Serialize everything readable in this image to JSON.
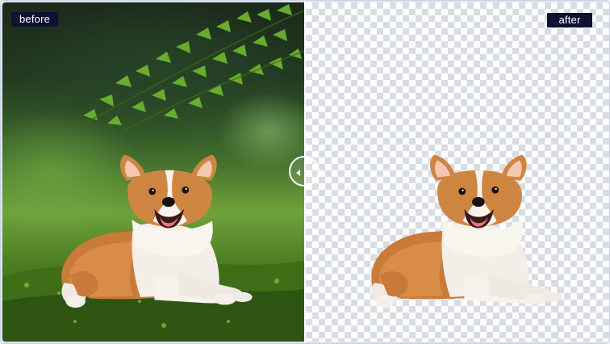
{
  "comparison": {
    "before_label": "before",
    "after_label": "after"
  },
  "images": {
    "before": "corgi-on-moss-photo",
    "after": "corgi-cutout-transparent"
  },
  "colors": {
    "label_background": "#0e1230",
    "label_text": "#ffffff",
    "checker_light": "#ffffff",
    "checker_dark": "#d9dde3",
    "divider": "#ffffff"
  },
  "icons": {
    "slider": "chevron-left-right-icon"
  }
}
